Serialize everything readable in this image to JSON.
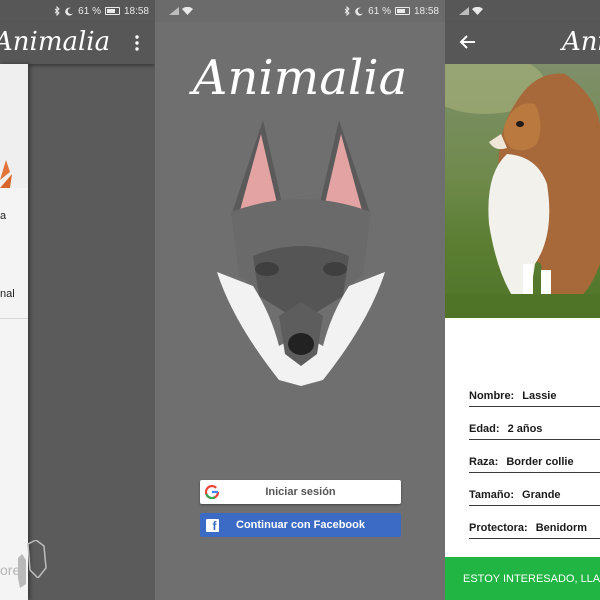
{
  "status": {
    "battery": "61 %",
    "time": "18:58"
  },
  "app": {
    "name": "Animalia"
  },
  "panel1": {
    "menu_fragments": [
      "a",
      "nal"
    ],
    "footer_fragment": "ore"
  },
  "login": {
    "google_label": "Iniciar sesión",
    "facebook_label": "Continuar con Facebook",
    "google_icon": "G",
    "facebook_icon": "f"
  },
  "detail": {
    "fields": [
      {
        "label": "Nombre:",
        "value": "Lassie"
      },
      {
        "label": "Edad:",
        "value": "2 años"
      },
      {
        "label": "Raza:",
        "value": "Border collie"
      },
      {
        "label": "Tamaño:",
        "value": "Grande"
      },
      {
        "label": "Protectora:",
        "value": "Benidorm"
      }
    ],
    "cta_label": "ESTOY INTERESADO, LLAMAR"
  },
  "colors": {
    "appbar": "#575757",
    "login_bg": "#6f6f6f",
    "facebook": "#3b6bc4",
    "cta": "#21b543"
  }
}
